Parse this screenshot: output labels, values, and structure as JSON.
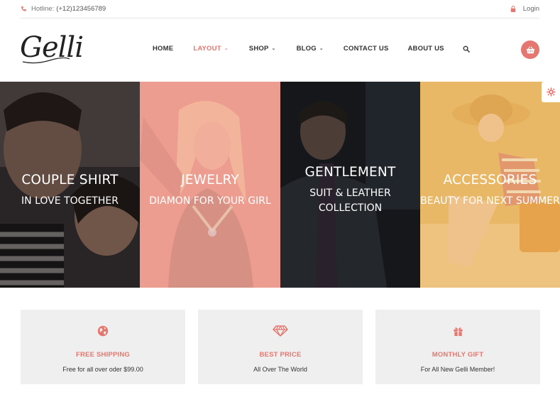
{
  "topbar": {
    "hotline_label": "Hotline:",
    "hotline_number": "(+12)123456789",
    "login": "Login"
  },
  "brand": {
    "logo": "Gelli"
  },
  "nav": {
    "items": [
      {
        "label": "HOME",
        "dropdown": false,
        "active": false
      },
      {
        "label": "LAYOUT",
        "dropdown": true,
        "active": true
      },
      {
        "label": "SHOP",
        "dropdown": true,
        "active": false
      },
      {
        "label": "BLOG",
        "dropdown": true,
        "active": false
      },
      {
        "label": "CONTACT US",
        "dropdown": false,
        "active": false
      },
      {
        "label": "ABOUT US",
        "dropdown": false,
        "active": false
      }
    ]
  },
  "banners": [
    {
      "title": "COUPLE SHIRT",
      "subtitle": "IN LOVE TOGETHER"
    },
    {
      "title": "JEWELRY",
      "subtitle": "DIAMON FOR YOUR GIRL"
    },
    {
      "title": "GENTLEMENT",
      "subtitle": "SUIT & LEATHER COLLECTION"
    },
    {
      "title": "ACCESSORIES",
      "subtitle": "BEAUTY FOR NEXT SUMMER"
    }
  ],
  "features": [
    {
      "icon": "globe-icon",
      "title": "FREE SHIPPING",
      "subtitle": "Free for all over oder $99.00"
    },
    {
      "icon": "diamond-icon",
      "title": "BEST PRICE",
      "subtitle": "All Over The World"
    },
    {
      "icon": "gift-icon",
      "title": "MONTHLY GIFT",
      "subtitle": "For All New Gelli Member!"
    }
  ],
  "colors": {
    "accent": "#e4776f",
    "feature_bg": "#efefef",
    "panel_pink": "#ec9f93",
    "panel_gold": "#e9b96a"
  }
}
